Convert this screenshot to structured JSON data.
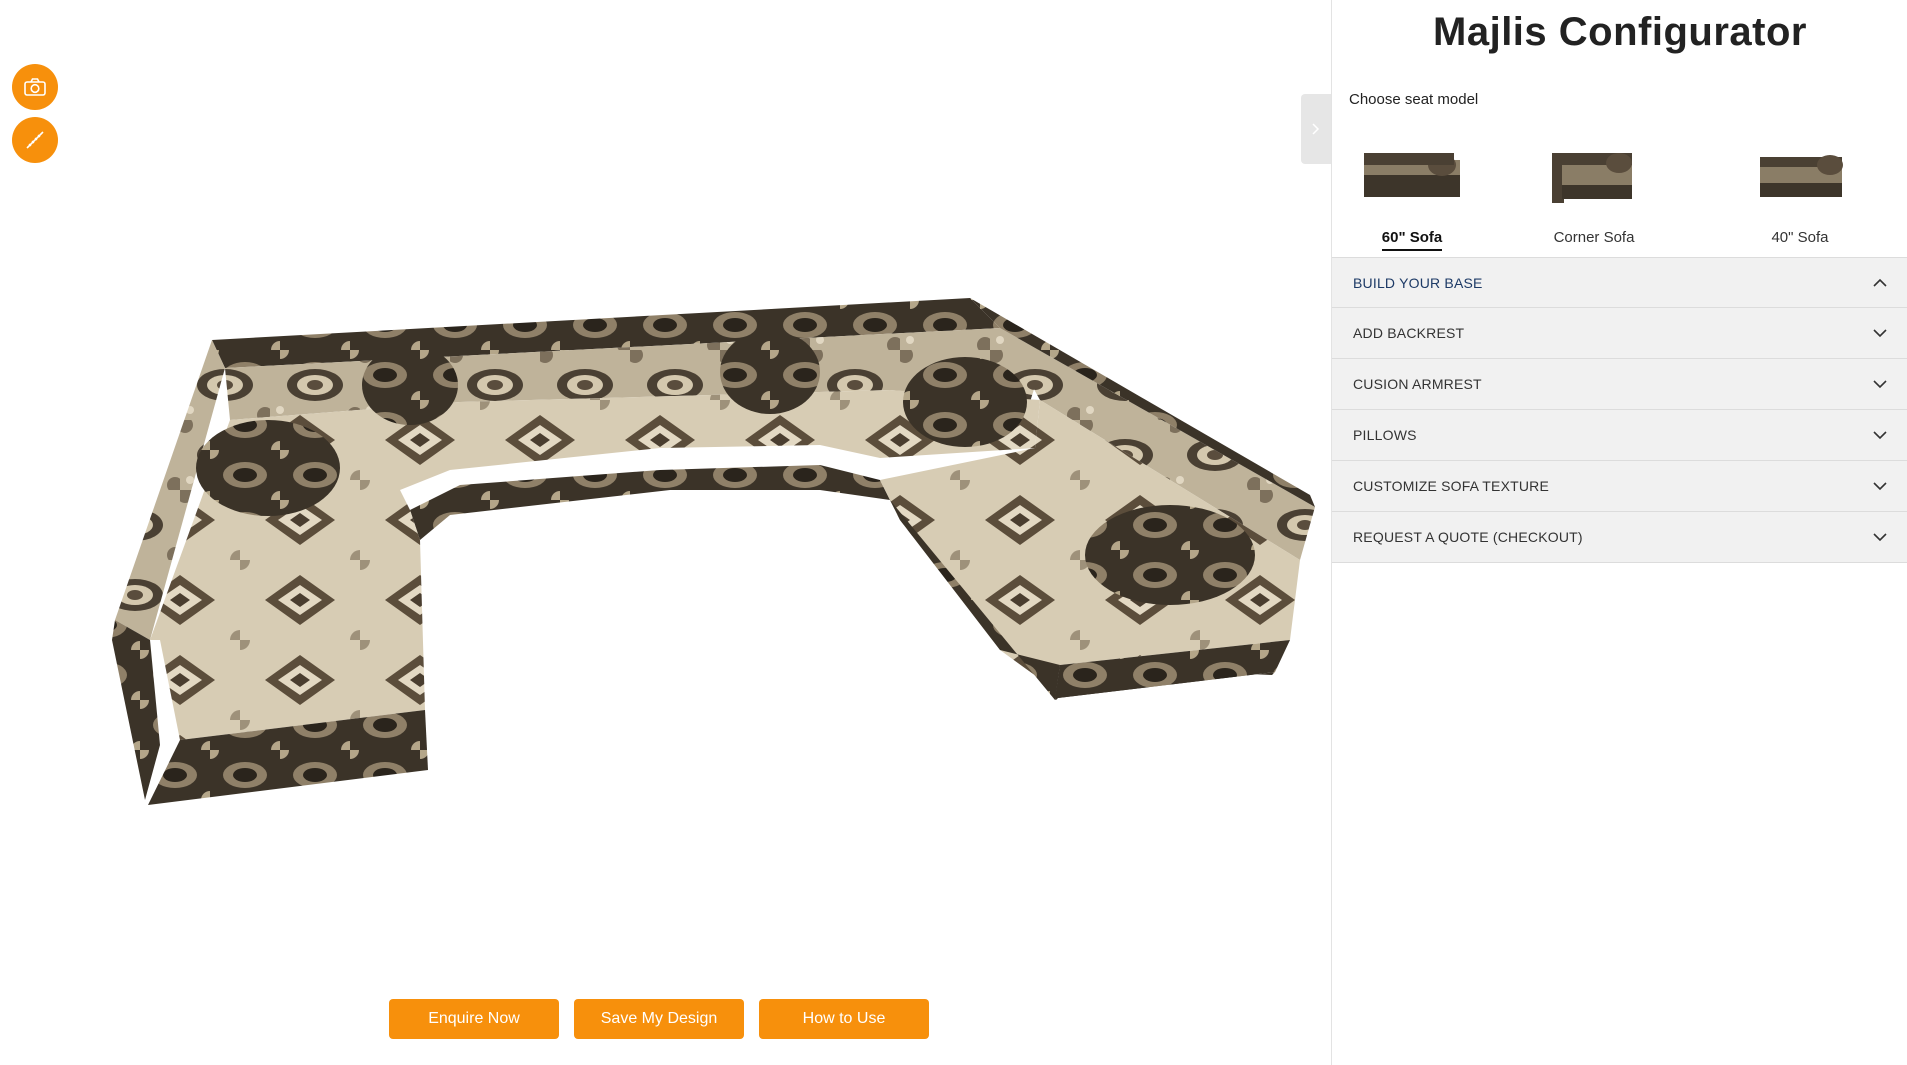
{
  "panel": {
    "title": "Majlis Configurator",
    "choose_label": "Choose seat model"
  },
  "seat_models": [
    {
      "label": "60\" Sofa",
      "selected": true
    },
    {
      "label": "Corner Sofa",
      "selected": false
    },
    {
      "label": "40\" Sofa",
      "selected": false
    }
  ],
  "accordion": [
    {
      "label": "BUILD YOUR BASE",
      "open": true
    },
    {
      "label": "ADD BACKREST",
      "open": false
    },
    {
      "label": "CUSION ARMREST",
      "open": false
    },
    {
      "label": "PILLOWS",
      "open": false
    },
    {
      "label": "CUSTOMIZE SOFA TEXTURE",
      "open": false
    },
    {
      "label": "REQUEST A QUOTE (CHECKOUT)",
      "open": false
    }
  ],
  "actions": {
    "enquire": "Enquire Now",
    "save": "Save My Design",
    "howto": "How to Use"
  },
  "tools": {
    "camera_icon": "camera-icon",
    "measure_icon": "ruler-icon"
  },
  "colors": {
    "accent": "#f7900c",
    "accordion_bg": "#f1f1f1",
    "open_label": "#1d3a66"
  }
}
